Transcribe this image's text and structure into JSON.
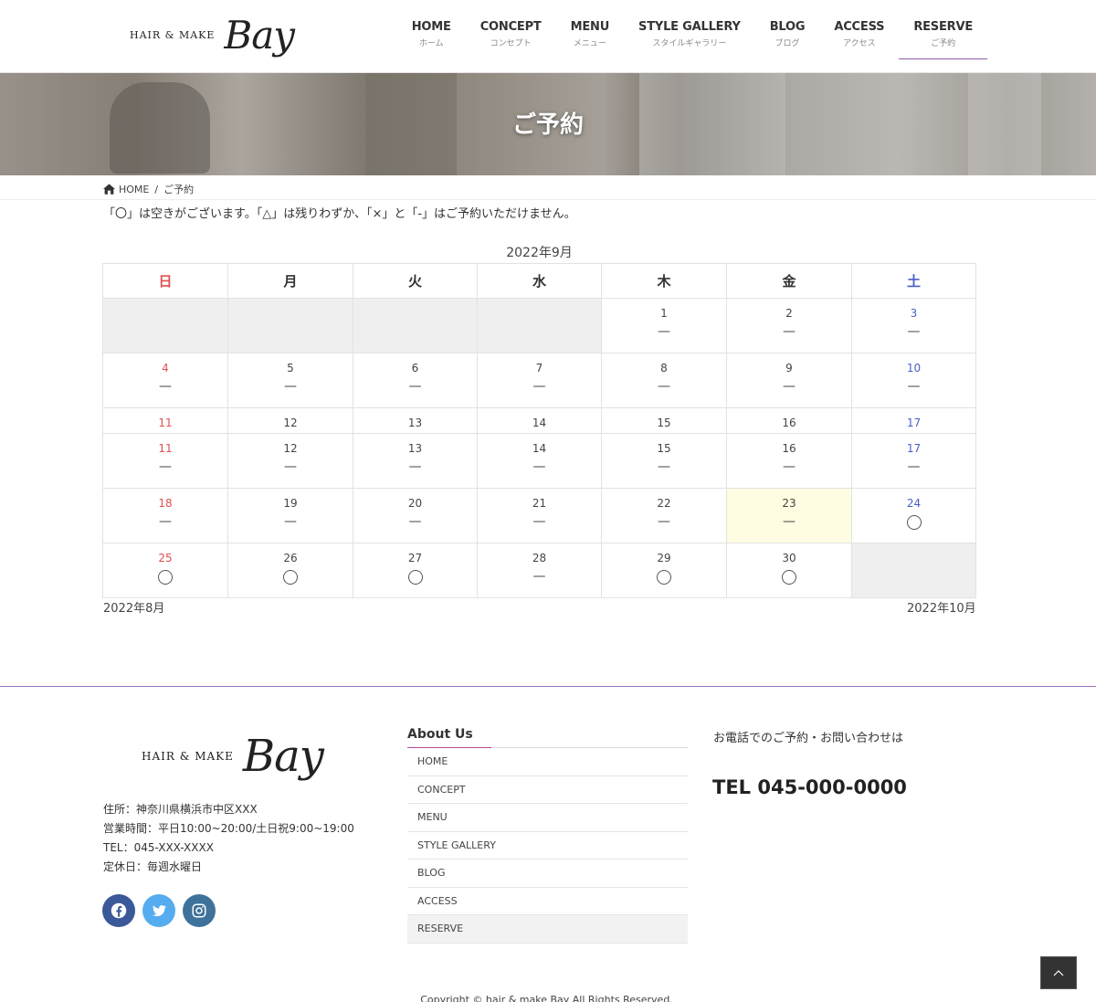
{
  "header": {
    "logo_small": "HAIR & MAKE",
    "logo_big": "Bay",
    "nav": [
      {
        "en": "HOME",
        "ja": "ホーム"
      },
      {
        "en": "CONCEPT",
        "ja": "コンセプト"
      },
      {
        "en": "MENU",
        "ja": "メニュー"
      },
      {
        "en": "STYLE GALLERY",
        "ja": "スタイルギャラリー"
      },
      {
        "en": "BLOG",
        "ja": "ブログ"
      },
      {
        "en": "ACCESS",
        "ja": "アクセス"
      },
      {
        "en": "RESERVE",
        "ja": "ご予約"
      }
    ]
  },
  "hero": {
    "title": "ご予約"
  },
  "breadcrumb": {
    "home": "HOME",
    "current": "ご予約"
  },
  "notice": "「〇」は空きがございます。「△」は残りわずか、「×」と「-」はご予約いただけません。",
  "calendar": {
    "month": "2022年9月",
    "weekdays": [
      "日",
      "月",
      "火",
      "水",
      "木",
      "金",
      "土"
    ],
    "rows": [
      {
        "type": "tall",
        "cells": [
          {
            "empty": true
          },
          {
            "empty": true
          },
          {
            "empty": true
          },
          {
            "empty": true
          },
          {
            "day": "1",
            "mark": "—"
          },
          {
            "day": "2",
            "mark": "—"
          },
          {
            "day": "3",
            "mark": "—"
          }
        ]
      },
      {
        "type": "tall",
        "cells": [
          {
            "day": "4",
            "mark": "—"
          },
          {
            "day": "5",
            "mark": "—"
          },
          {
            "day": "6",
            "mark": "—"
          },
          {
            "day": "7",
            "mark": "—"
          },
          {
            "day": "8",
            "mark": "—"
          },
          {
            "day": "9",
            "mark": "—"
          },
          {
            "day": "10",
            "mark": "—"
          }
        ]
      },
      {
        "type": "short",
        "cells": [
          {
            "day": "11"
          },
          {
            "day": "12"
          },
          {
            "day": "13"
          },
          {
            "day": "14"
          },
          {
            "day": "15"
          },
          {
            "day": "16"
          },
          {
            "day": "17"
          }
        ]
      },
      {
        "type": "tall",
        "cells": [
          {
            "day": "11",
            "mark": "—"
          },
          {
            "day": "12",
            "mark": "—"
          },
          {
            "day": "13",
            "mark": "—"
          },
          {
            "day": "14",
            "mark": "—"
          },
          {
            "day": "15",
            "mark": "—"
          },
          {
            "day": "16",
            "mark": "—"
          },
          {
            "day": "17",
            "mark": "—"
          }
        ]
      },
      {
        "type": "tall",
        "cells": [
          {
            "day": "18",
            "mark": "—"
          },
          {
            "day": "19",
            "mark": "—"
          },
          {
            "day": "20",
            "mark": "—"
          },
          {
            "day": "21",
            "mark": "—"
          },
          {
            "day": "22",
            "mark": "—"
          },
          {
            "day": "23",
            "mark": "—",
            "today": true
          },
          {
            "day": "24",
            "mark": "〇"
          }
        ]
      },
      {
        "type": "tall",
        "cells": [
          {
            "day": "25",
            "mark": "〇"
          },
          {
            "day": "26",
            "mark": "〇"
          },
          {
            "day": "27",
            "mark": "〇"
          },
          {
            "day": "28",
            "mark": "—"
          },
          {
            "day": "29",
            "mark": "〇"
          },
          {
            "day": "30",
            "mark": "〇"
          },
          {
            "empty": true
          }
        ]
      }
    ],
    "prev": "2022年8月",
    "next": "2022年10月"
  },
  "footer": {
    "logo_small": "HAIR & MAKE",
    "logo_big": "Bay",
    "address": "住所：神奈川県横浜市中区XXX",
    "hours": "営業時間：平日10:00~20:00/土日祝9:00~19:00",
    "tel": "TEL：045-XXX-XXXX",
    "closed": "定休日：毎週水曜日",
    "about_title": "About Us",
    "about_links": [
      "HOME",
      "CONCEPT",
      "MENU",
      "STYLE GALLERY",
      "BLOG",
      "ACCESS",
      "RESERVE"
    ],
    "contact_label": "お電話でのご予約・お問い合わせは",
    "tel_big": "TEL 045-000-0000",
    "copyright": "Copyright © hair & make Bay All Rights Reserved."
  },
  "icons": {
    "social": [
      "facebook-icon",
      "twitter-icon",
      "instagram-icon"
    ],
    "home": "home-icon",
    "to_top": "chevron-up-icon"
  },
  "colors": {
    "accent": "#8e5fb0",
    "sunday": "#e05050",
    "saturday": "#4a5ec8",
    "today_bg": "#fefde1",
    "facebook": "#3b5998",
    "twitter": "#55acee",
    "instagram": "#3f729b"
  }
}
